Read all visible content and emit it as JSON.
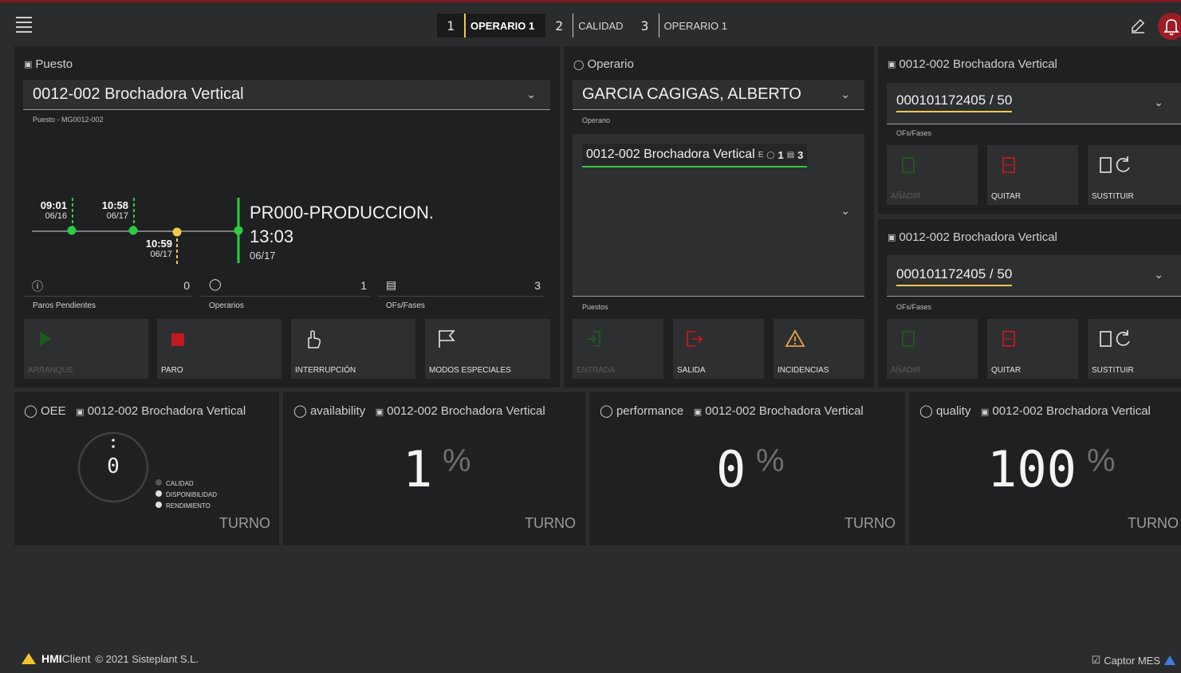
{
  "topbar": {
    "tabs": [
      {
        "num": "1",
        "label": "OPERARIO 1"
      },
      {
        "num": "2",
        "label": "CALIDAD"
      },
      {
        "num": "3",
        "label": "OPERARIO 1"
      }
    ],
    "alert_color": "#9c1c24"
  },
  "puesto": {
    "title": "Puesto",
    "selected": "0012-002 Brochadora Vertical",
    "sublabel": "Puesto - MG0012-002",
    "timeline": [
      {
        "time": "09:01",
        "date": "06/16"
      },
      {
        "time": "10:58",
        "date": "06/17"
      },
      {
        "time": "10:59",
        "date": "06/17"
      }
    ],
    "current_state": "PR000-PRODUCCION.",
    "current_time": "13:03",
    "current_date": "06/17",
    "counters": [
      {
        "value": "0",
        "label": "Paros Pendientes"
      },
      {
        "value": "1",
        "label": "Operarios"
      },
      {
        "value": "3",
        "label": "OFs/Fases"
      }
    ],
    "buttons": [
      "ARRANQUE",
      "PARO",
      "INTERRUPCIÓN",
      "MODOS ESPECIALES"
    ]
  },
  "operario": {
    "title": "Operario",
    "selected": "GARCIA CAGIGAS, ALBERTO",
    "sublabel": "Operario",
    "chip_text": "0012-002 Brochadora Vertical",
    "chip_e": "E",
    "chip_ops": "1",
    "chip_ofs": "3",
    "list_label": "Puestos",
    "buttons": [
      "ENTRADA",
      "SALIDA",
      "INCIDENCIAS"
    ]
  },
  "ofs_panels": [
    {
      "title": "0012-002 Brochadora Vertical",
      "selected": "000101172405 / 50",
      "sublabel": "OFs/Fases",
      "buttons": [
        "AÑADIR",
        "QUITAR",
        "SUSTITUIR"
      ]
    },
    {
      "title": "0012-002 Brochadora Vertical",
      "selected": "000101172405 / 50",
      "sublabel": "OFs/Fases",
      "buttons": [
        "AÑADIR",
        "QUITAR",
        "SUSTITUIR"
      ]
    }
  ],
  "kpis": {
    "oee": {
      "label": "OEE",
      "machine": "0012-002 Brochadora Vertical",
      "value": "0",
      "legend": [
        "CALIDAD",
        "DISPONIBILIDAD",
        "RENDIMIENTO"
      ],
      "period": "TURNO"
    },
    "availability": {
      "label": "availability",
      "machine": "0012-002 Brochadora Vertical",
      "value": "1",
      "unit": "%",
      "period": "TURNO"
    },
    "performance": {
      "label": "performance",
      "machine": "0012-002 Brochadora Vertical",
      "value": "0",
      "unit": "%",
      "period": "TURNO"
    },
    "quality": {
      "label": "quality",
      "machine": "0012-002 Brochadora Vertical",
      "value": "100",
      "unit": "%",
      "period": "TURNO"
    }
  },
  "footer": {
    "brand_bold": "HMI",
    "brand_rest": "Client",
    "copyright": "© 2021 Sisteplant S.L.",
    "right": "Captor MES"
  },
  "colors": {
    "green": "#2ecc40",
    "yellow": "#f2c94c",
    "red": "#c0191f",
    "orange": "#e8a33c"
  }
}
